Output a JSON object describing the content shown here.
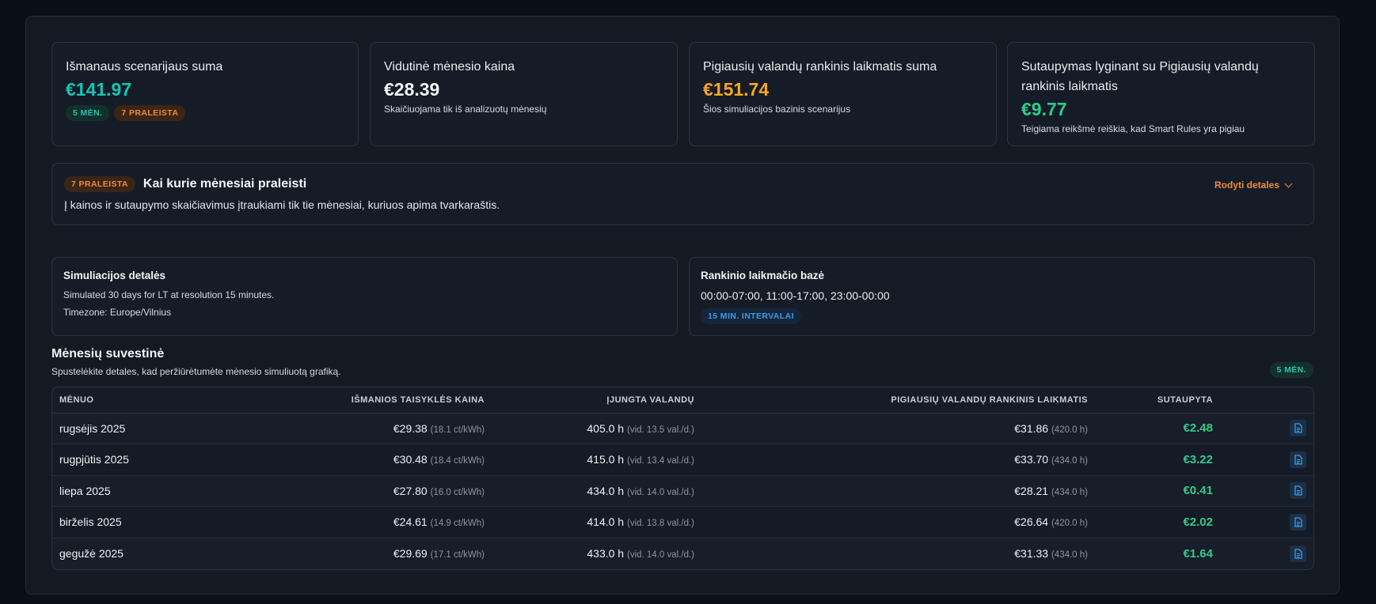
{
  "stats": [
    {
      "label": "Išmanaus scenarijaus suma",
      "value": "€141.97",
      "pills": [
        "5 MĖN.",
        "7 PRALEISTA"
      ]
    },
    {
      "label": "Vidutinė mėnesio kaina",
      "value": "€28.39",
      "sub": "Skaičiuojama tik iš analizuotų mėnesių"
    },
    {
      "label": "Pigiausių valandų rankinis laikmatis suma",
      "value": "€151.74",
      "sub": "Šios simuliacijos bazinis scenarijus"
    },
    {
      "label": "Sutaupymas lyginant su Pigiausių valandų rankinis laikmatis",
      "value": "€9.77",
      "sub": "Teigiama reikšmė reiškia, kad Smart Rules yra pigiau"
    }
  ],
  "notice": {
    "badge": "7 PRALEISTA",
    "title": "Kai kurie mėnesiai praleisti",
    "desc": "Į kainos ir sutaupymo skaičiavimus įtraukiami tik tie mėnesiai, kuriuos apima tvarkaraštis.",
    "details_label": "Rodyti detales"
  },
  "simulation": {
    "title": "Simuliacijos detalės",
    "line1": "Simulated 30 days for LT at resolution 15 minutes.",
    "line2": "Timezone: Europe/Vilnius"
  },
  "manual": {
    "title": "Rankinio laikmačio bazė",
    "schedule": "00:00-07:00, 11:00-17:00, 23:00-00:00",
    "pill": "15 MIN. INTERVALAI"
  },
  "summary": {
    "title": "Mėnesių suvestinė",
    "subtitle": "Spustelėkite detales, kad peržiūrėtumėte mėnesio simuliuotą grafiką.",
    "pill": "5 MĖN.",
    "headers": [
      "MĖNUO",
      "IŠMANIOS TAISYKLĖS KAINA",
      "ĮJUNGTA VALANDŲ",
      "PIGIAUSIŲ VALANDŲ RANKINIS LAIKMATIS",
      "SUTAUPYTA"
    ],
    "rows": [
      {
        "month": "rugsėjis 2025",
        "price": "€29.38",
        "price_rate": "(18.1 ct/kWh)",
        "hours": "405.0 h",
        "hours_avg": "(vid. 13.5 val./d.)",
        "manual": "€31.86",
        "manual_hours": "(420.0 h)",
        "saved": "€2.48"
      },
      {
        "month": "rugpjūtis 2025",
        "price": "€30.48",
        "price_rate": "(18.4 ct/kWh)",
        "hours": "415.0 h",
        "hours_avg": "(vid. 13.4 val./d.)",
        "manual": "€33.70",
        "manual_hours": "(434.0 h)",
        "saved": "€3.22"
      },
      {
        "month": "liepa 2025",
        "price": "€27.80",
        "price_rate": "(16.0 ct/kWh)",
        "hours": "434.0 h",
        "hours_avg": "(vid. 14.0 val./d.)",
        "manual": "€28.21",
        "manual_hours": "(434.0 h)",
        "saved": "€0.41"
      },
      {
        "month": "birželis 2025",
        "price": "€24.61",
        "price_rate": "(14.9 ct/kWh)",
        "hours": "414.0 h",
        "hours_avg": "(vid. 13.8 val./d.)",
        "manual": "€26.64",
        "manual_hours": "(420.0 h)",
        "saved": "€2.02"
      },
      {
        "month": "gegužė 2025",
        "price": "€29.69",
        "price_rate": "(17.1 ct/kWh)",
        "hours": "433.0 h",
        "hours_avg": "(vid. 14.0 val./d.)",
        "manual": "€31.33",
        "manual_hours": "(434.0 h)",
        "saved": "€1.64"
      }
    ]
  },
  "colors": {
    "teal": "#14c4b4",
    "orange": "#f5a623",
    "green": "#2ecc8a"
  }
}
